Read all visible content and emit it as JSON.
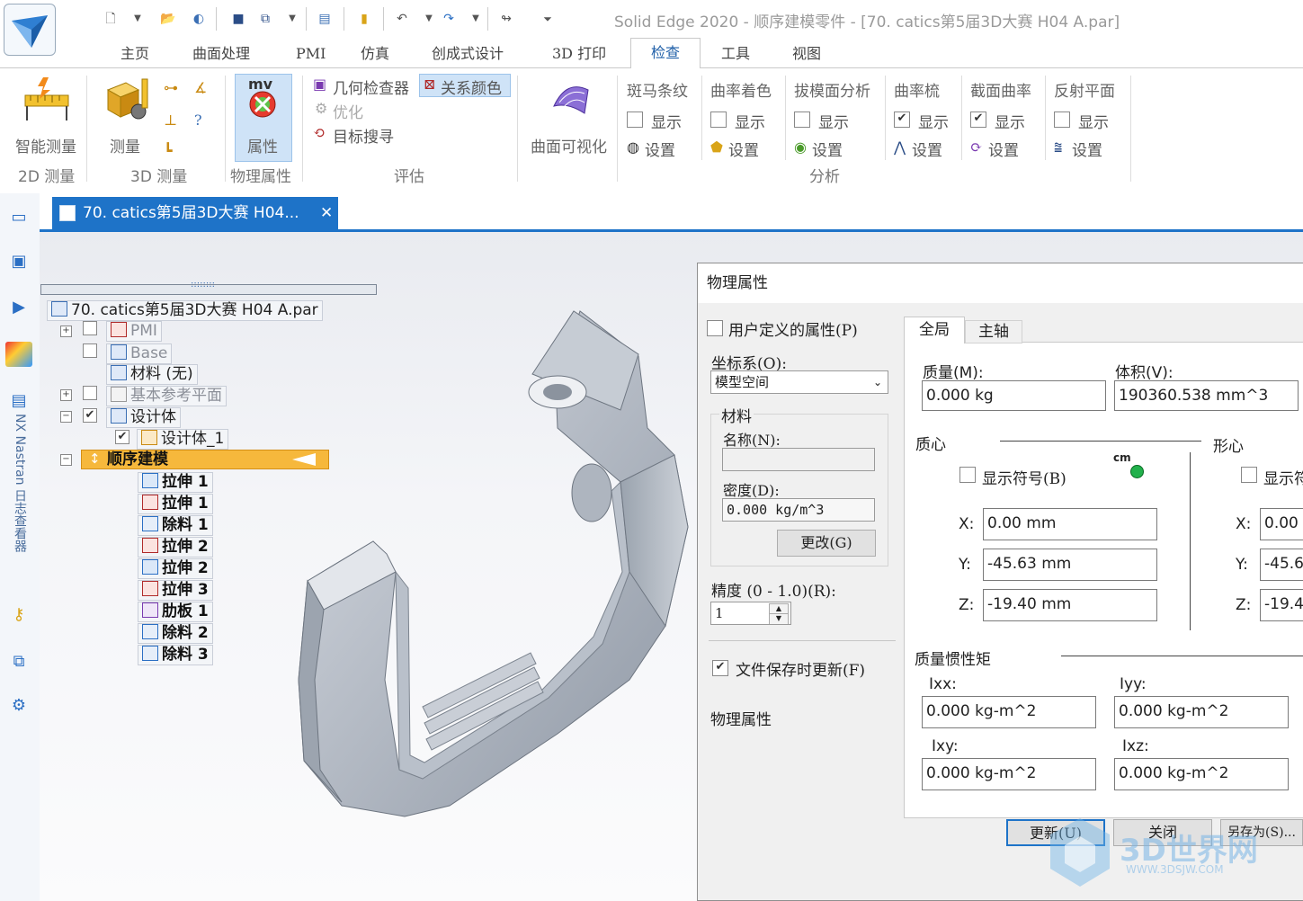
{
  "window": {
    "title": "Solid Edge 2020 - 顺序建模零件 - [70. catics第5届3D大赛 H04 A.par]"
  },
  "ribbon": {
    "tabs": [
      "主页",
      "曲面处理",
      "PMI",
      "仿真",
      "创成式设计",
      "3D 打印",
      "检查",
      "工具",
      "视图"
    ],
    "active_tab": "检查",
    "groups": {
      "measure2d": {
        "button": "智能测量",
        "label": "2D 测量"
      },
      "measure3d": {
        "button": "测量",
        "label": "3D 测量"
      },
      "physprops": {
        "button": "属性",
        "label": "物理属性",
        "icon_text": "mv"
      },
      "evaluate": {
        "geom_checker": "几何检查器",
        "relation_color": "关系颜色",
        "optimize": "优化",
        "target_search": "目标搜寻",
        "label": "评估"
      },
      "surface_viz": {
        "button": "曲面可视化"
      },
      "analysis": {
        "label": "分析",
        "items": [
          {
            "title": "斑马条纹",
            "show": "显示",
            "settings": "设置",
            "checked": false
          },
          {
            "title": "曲率着色",
            "show": "显示",
            "settings": "设置",
            "checked": false
          },
          {
            "title": "拔模面分析",
            "show": "显示",
            "settings": "设置",
            "checked": false
          },
          {
            "title": "曲率梳",
            "show": "显示",
            "settings": "设置",
            "checked": true
          },
          {
            "title": "截面曲率",
            "show": "显示",
            "settings": "设置",
            "checked": true
          },
          {
            "title": "反射平面",
            "show": "显示",
            "settings": "设置",
            "checked": false
          }
        ]
      }
    }
  },
  "leftbar": {
    "vertical_text": "NX Nastran 日志查看器"
  },
  "doc_tab": {
    "title": "70. catics第5届3D大赛 H04...",
    "close": "✕"
  },
  "tree": {
    "head_grip": "::::::::",
    "root": "70. catics第5届3D大赛 H04 A.par",
    "pmi": "PMI",
    "base": "Base",
    "material": "材料 (无)",
    "ref_planes": "基本参考平面",
    "design_body": "设计体",
    "design_body_1": "设计体_1",
    "seq_modeling": "顺序建模",
    "features": [
      "拉伸 1",
      "拉伸 1",
      "除料 1",
      "拉伸 2",
      "拉伸 2",
      "拉伸 3",
      "肋板 1",
      "除料 2",
      "除料 3"
    ]
  },
  "dialog": {
    "title": "物理属性",
    "user_defined": "用户定义的属性(P)",
    "coord_label": "坐标系(O):",
    "coord_value": "模型空间",
    "material_group": "材料",
    "name_label": "名称(N):",
    "name_value": "",
    "density_label": "密度(D):",
    "density_value": "0.000 kg/m^3",
    "change_btn": "更改(G)",
    "precision_label": "精度 (0 - 1.0)(R):",
    "precision_value": "1",
    "save_update": "文件保存时更新(F)",
    "save_update_checked": true,
    "phys_label": "物理属性",
    "tabs": [
      "全局",
      "主轴"
    ],
    "mass_label": "质量(M):",
    "mass_value": "0.000 kg",
    "volume_label": "体积(V):",
    "volume_value": "190360.538 mm^3",
    "centroid_label": "质心",
    "shape_center_label": "形心",
    "show_symbol": "显示符号(B)",
    "show_symbol_short": "显示符",
    "cm_tag": "cm",
    "x_label": "X:",
    "y_label": "Y:",
    "z_label": "Z:",
    "cx": "0.00 mm",
    "cy": "-45.63 mm",
    "cz": "-19.40 mm",
    "sx": "0.00",
    "sy": "-45.6",
    "sz": "-19.4",
    "inertia_label": "质量惯性矩",
    "ixx_label": "Ixx:",
    "iyy_label": "Iyy:",
    "ixy_label": "Ixy:",
    "ixz_label": "Ixz:",
    "ixx": "0.000 kg-m^2",
    "iyy": "0.000 kg-m^2",
    "ixy": "0.000 kg-m^2",
    "ixz": "0.000 kg-m^2",
    "update_btn": "更新(U)",
    "close_btn": "关闭",
    "saveas_btn": "另存为(S)..."
  },
  "watermark": {
    "text": "3D世界网",
    "url": "WWW.3DSJW.COM"
  },
  "colors": {
    "accent": "#1e73c8",
    "highlight": "#f6b83c",
    "part": "#aab3bf"
  }
}
